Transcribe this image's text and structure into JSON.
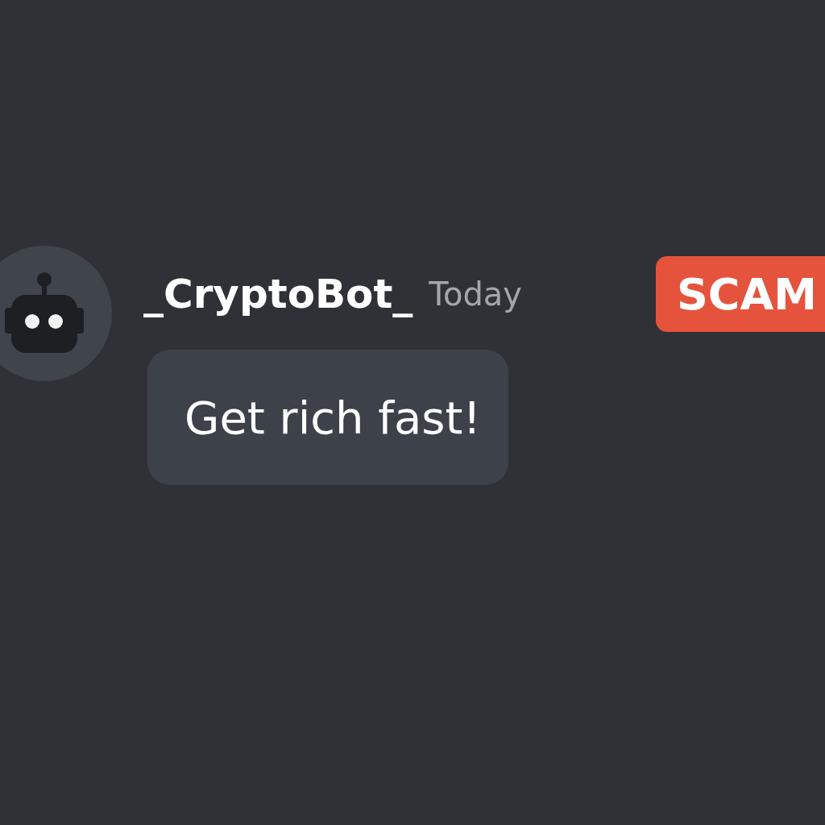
{
  "message": {
    "author": "_CryptoBot_",
    "timestamp": "Today",
    "badge": "SCAM",
    "text": "Get rich fast!"
  }
}
